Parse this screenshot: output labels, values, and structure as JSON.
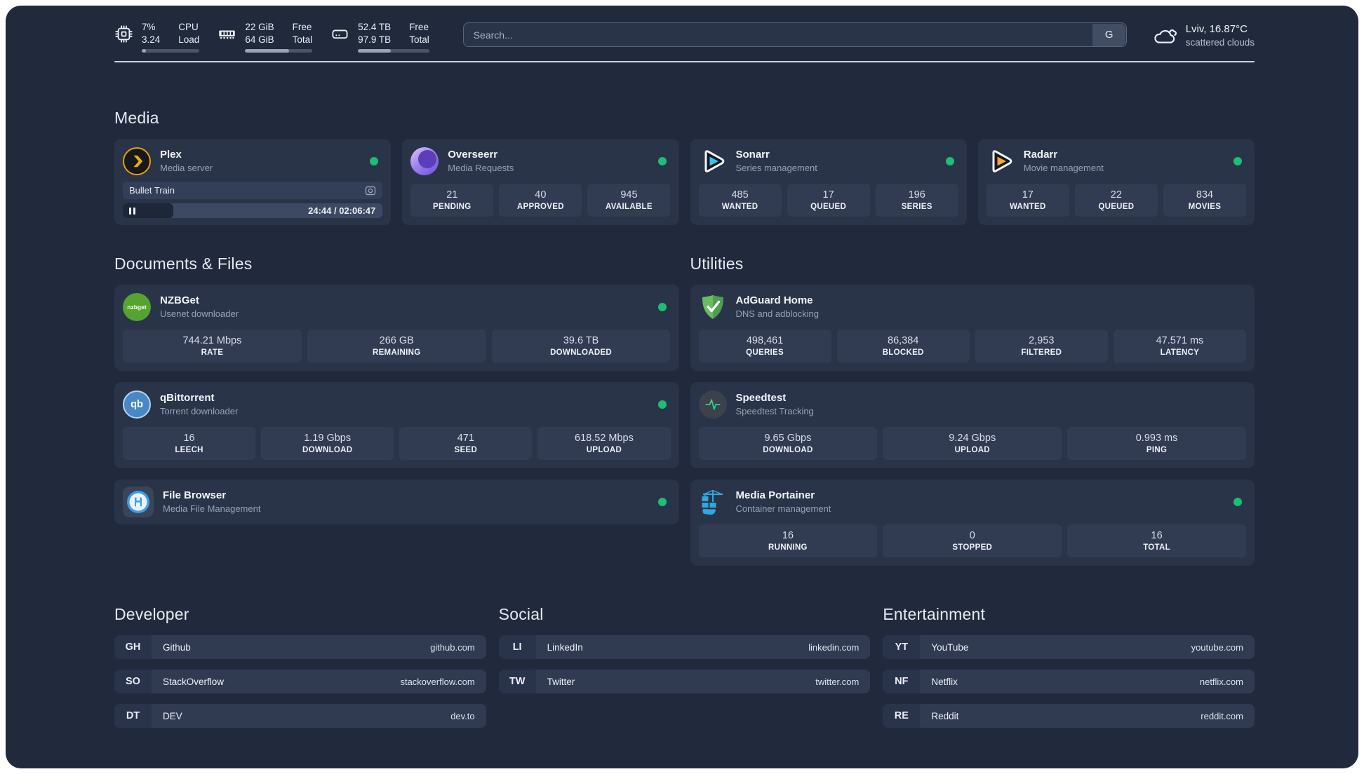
{
  "topbar": {
    "cpu": {
      "value_top": "7%",
      "value_bottom": "3.24",
      "label_top": "CPU",
      "label_bottom": "Load",
      "bar_percent": 7
    },
    "ram": {
      "value_top": "22 GiB",
      "value_bottom": "64 GiB",
      "label_top": "Free",
      "label_bottom": "Total",
      "bar_percent": 65
    },
    "disk": {
      "value_top": "52.4 TB",
      "value_bottom": "97.9 TB",
      "label_top": "Free",
      "label_bottom": "Total",
      "bar_percent": 46
    },
    "search": {
      "placeholder": "Search...",
      "engine_label": "G"
    },
    "weather": {
      "line1": "Lviv, 16.87°C",
      "line2": "scattered clouds"
    }
  },
  "sections": {
    "media": "Media",
    "documents": "Documents & Files",
    "utilities": "Utilities",
    "developer": "Developer",
    "social": "Social",
    "entertainment": "Entertainment"
  },
  "services": {
    "plex": {
      "name": "Plex",
      "subtitle": "Media server",
      "online": true,
      "now_playing_title": "Bullet Train",
      "time": "24:44 / 02:06:47",
      "progress_percent": 19.5
    },
    "overseerr": {
      "name": "Overseerr",
      "subtitle": "Media Requests",
      "online": true,
      "stats": [
        {
          "value": "21",
          "label": "PENDING"
        },
        {
          "value": "40",
          "label": "APPROVED"
        },
        {
          "value": "945",
          "label": "AVAILABLE"
        }
      ]
    },
    "sonarr": {
      "name": "Sonarr",
      "subtitle": "Series management",
      "online": true,
      "stats": [
        {
          "value": "485",
          "label": "WANTED"
        },
        {
          "value": "17",
          "label": "QUEUED"
        },
        {
          "value": "196",
          "label": "SERIES"
        }
      ]
    },
    "radarr": {
      "name": "Radarr",
      "subtitle": "Movie management",
      "online": true,
      "stats": [
        {
          "value": "17",
          "label": "WANTED"
        },
        {
          "value": "22",
          "label": "QUEUED"
        },
        {
          "value": "834",
          "label": "MOVIES"
        }
      ]
    },
    "nzbget": {
      "name": "NZBGet",
      "subtitle": "Usenet downloader",
      "online": true,
      "icon_text": "nzbget",
      "stats": [
        {
          "value": "744.21 Mbps",
          "label": "RATE"
        },
        {
          "value": "266 GB",
          "label": "REMAINING"
        },
        {
          "value": "39.6 TB",
          "label": "DOWNLOADED"
        }
      ]
    },
    "qbittorrent": {
      "name": "qBittorrent",
      "subtitle": "Torrent downloader",
      "online": true,
      "icon_text": "qb",
      "stats": [
        {
          "value": "16",
          "label": "LEECH"
        },
        {
          "value": "1.19 Gbps",
          "label": "DOWNLOAD"
        },
        {
          "value": "471",
          "label": "SEED"
        },
        {
          "value": "618.52 Mbps",
          "label": "UPLOAD"
        }
      ]
    },
    "filebrowser": {
      "name": "File Browser",
      "subtitle": "Media File Management",
      "online": true
    },
    "adguard": {
      "name": "AdGuard Home",
      "subtitle": "DNS and adblocking",
      "stats": [
        {
          "value": "498,461",
          "label": "QUERIES"
        },
        {
          "value": "86,384",
          "label": "BLOCKED"
        },
        {
          "value": "2,953",
          "label": "FILTERED"
        },
        {
          "value": "47.571 ms",
          "label": "LATENCY"
        }
      ]
    },
    "speedtest": {
      "name": "Speedtest",
      "subtitle": "Speedtest Tracking",
      "stats": [
        {
          "value": "9.65 Gbps",
          "label": "DOWNLOAD"
        },
        {
          "value": "9.24 Gbps",
          "label": "UPLOAD"
        },
        {
          "value": "0.993 ms",
          "label": "PING"
        }
      ]
    },
    "portainer": {
      "name": "Media Portainer",
      "subtitle": "Container management",
      "online": true,
      "stats": [
        {
          "value": "16",
          "label": "RUNNING"
        },
        {
          "value": "0",
          "label": "STOPPED"
        },
        {
          "value": "16",
          "label": "TOTAL"
        }
      ]
    }
  },
  "links": {
    "developer": [
      {
        "abbr": "GH",
        "name": "Github",
        "url": "github.com"
      },
      {
        "abbr": "SO",
        "name": "StackOverflow",
        "url": "stackoverflow.com"
      },
      {
        "abbr": "DT",
        "name": "DEV",
        "url": "dev.to"
      }
    ],
    "social": [
      {
        "abbr": "LI",
        "name": "LinkedIn",
        "url": "linkedin.com"
      },
      {
        "abbr": "TW",
        "name": "Twitter",
        "url": "twitter.com"
      }
    ],
    "entertainment": [
      {
        "abbr": "YT",
        "name": "YouTube",
        "url": "youtube.com"
      },
      {
        "abbr": "NF",
        "name": "Netflix",
        "url": "netflix.com"
      },
      {
        "abbr": "RE",
        "name": "Reddit",
        "url": "reddit.com"
      }
    ]
  },
  "icons": {
    "cpu": "cpu-chip",
    "ram": "memory-stick",
    "disk": "hard-drive",
    "weather": "scattered-clouds",
    "plex": "plex-chevron",
    "overseerr": "overseerr-eye",
    "sonarr": "play-triangle-blue",
    "radarr": "play-triangle-amber",
    "adguard": "shield-check",
    "speedtest": "pulse-line",
    "portainer": "crane-containers",
    "filebrowser": "floppy-circle",
    "plex_player": "pause",
    "now_playing": "cast"
  },
  "colors": {
    "background": "#212a3d",
    "card": "#2a3449",
    "tile": "#313c53",
    "status_online": "#1dbe78",
    "divider": "#ccd4df",
    "plex_amber": "#e5a00d",
    "sonarr_blue": "#35c5f4",
    "radarr_amber": "#f7a928",
    "adguard_green": "#5cb85c",
    "portainer_blue": "#2fa8e0"
  }
}
